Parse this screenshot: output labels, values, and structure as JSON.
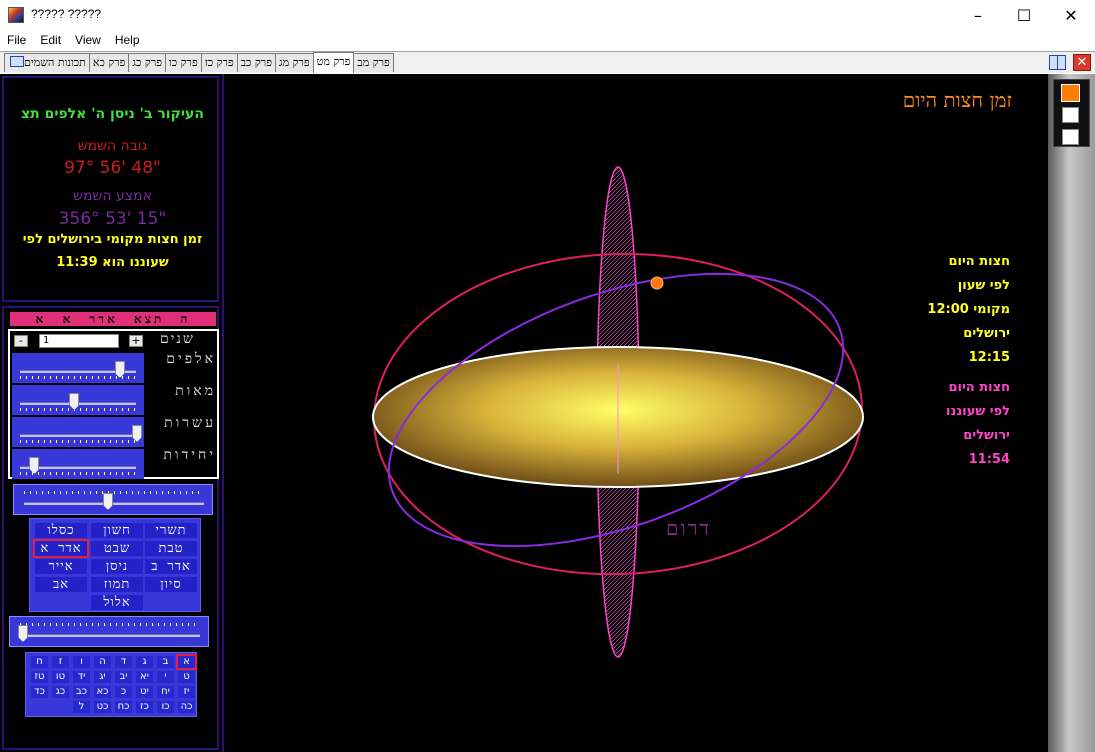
{
  "window": {
    "title": "????? ?????"
  },
  "menu": [
    "File",
    "Edit",
    "View",
    "Help"
  ],
  "tabs": [
    {
      "label": "תכונות השמים",
      "book": true
    },
    {
      "label": "פרק כא"
    },
    {
      "label": "פרק כג"
    },
    {
      "label": "פרק כו"
    },
    {
      "label": "פרק כז"
    },
    {
      "label": "פרק כב"
    },
    {
      "label": "פרק מג"
    },
    {
      "label": "פרק מט",
      "active": true
    },
    {
      "label": "פרק מב"
    }
  ],
  "info": {
    "title": "העיקור ב' ניסן ה' אלפים תצ",
    "sun_height_label": "גובה השמש",
    "sun_height_value": "97° 56' 48\"",
    "sun_mid_label": "אמצע השמש",
    "sun_mid_value": "356° 53' 15\"",
    "local_line1": "זמן חצות מקומי בירושלים לפי",
    "local_line2": "שעוננו הוא 11:39"
  },
  "controls": {
    "date_bar": "ה תצא אדר א א",
    "years_label": "שנים",
    "years_value": "1",
    "minus": "-",
    "plus": "+",
    "rows": [
      {
        "label": "אלפים",
        "level": 0.85
      },
      {
        "label": "מאות",
        "level": 0.45
      },
      {
        "label": "עשרות",
        "level": 1.0
      },
      {
        "label": "יחידות",
        "level": 0.1
      }
    ],
    "month_level": 0.45,
    "months": [
      "תשרי",
      "חשון",
      "כסלו",
      "טבת",
      "שבט",
      "אדר א",
      "אדר ב",
      "ניסן",
      "אייר",
      "סיון",
      "תמוז",
      "אב",
      "אלול"
    ],
    "selected_month": "אדר א",
    "day_level": 0.0,
    "days": [
      "א",
      "ב",
      "ג",
      "ד",
      "ה",
      "ו",
      "ז",
      "ח",
      "ט",
      "י",
      "יא",
      "יב",
      "יג",
      "יד",
      "טו",
      "טז",
      "יז",
      "יח",
      "יט",
      "כ",
      "כא",
      "כב",
      "כג",
      "כד",
      "כה",
      "כו",
      "כז",
      "כח",
      "כט",
      "ל"
    ],
    "selected_day": "א"
  },
  "main": {
    "title": "זמן חצות היום",
    "south_label": "דרום",
    "yellow_lines": [
      "חצות היום",
      "לפי שעון",
      "מקומי 12:00",
      "ירושלים",
      "12:15"
    ],
    "pink_lines": [
      "חצות היום",
      "לפי שעוננו",
      "ירושלים",
      "11:54"
    ]
  },
  "colors": {
    "orange": "#ff8c1a",
    "yellow": "#ffff22",
    "pink": "#ff44cc",
    "purple_orbit": "#8a2be2",
    "red_orbit": "#e0205a",
    "green": "#44dd44"
  }
}
